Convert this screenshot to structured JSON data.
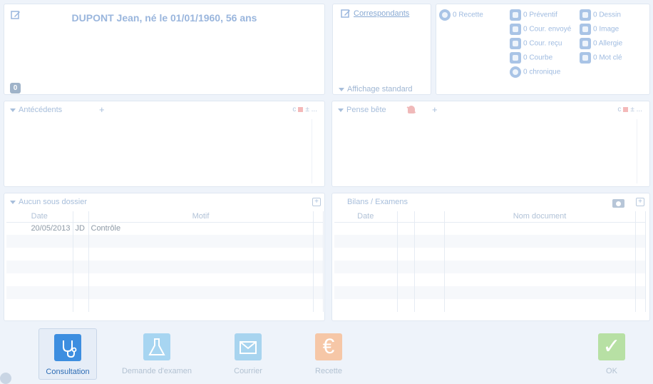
{
  "patient": {
    "title": "DUPONT Jean, né le 01/01/1960, 56 ans",
    "counter": "0"
  },
  "correspondants": {
    "link": "Correspondants",
    "display": "Affichage standard"
  },
  "counts": {
    "recette": "0 Recette",
    "preventif": "0 Préventif",
    "cour_envoye": "0 Cour. envoyé",
    "cour_recu": "0 Cour. reçu",
    "courbe": "0 Courbe",
    "chronique": "0 chronique",
    "dessin": "0 Dessin",
    "image": "0 Image",
    "allergie": "0 Allergie",
    "mot_cle": "0 Mot clé"
  },
  "antecedents": {
    "title": "Antécédents",
    "plus": "+",
    "tools_c": "c",
    "tools_rest": "± ..."
  },
  "pense_bete": {
    "title": "Pense bête",
    "plus": "+",
    "tools_c": "c",
    "tools_rest": "± ..."
  },
  "dossier": {
    "title": "Aucun sous dossier",
    "headers": {
      "date": "Date",
      "user": "",
      "motif": "Motif"
    },
    "rows": [
      {
        "date": "20/05/2013",
        "user": "JD",
        "motif": "Contrôle"
      }
    ]
  },
  "bilans": {
    "title": "Bilans / Examens",
    "headers": {
      "date": "Date",
      "nom": "Nom document"
    }
  },
  "toolbar": {
    "consultation": "Consultation",
    "demande_examen": "Demande d'examen",
    "courrier": "Courrier",
    "recette": "Recette",
    "recette_symbol": "€",
    "ok": "OK",
    "ok_symbol": "✓"
  },
  "colors": {
    "accent": "#3d8ee0",
    "title": "#9ab6dd"
  }
}
